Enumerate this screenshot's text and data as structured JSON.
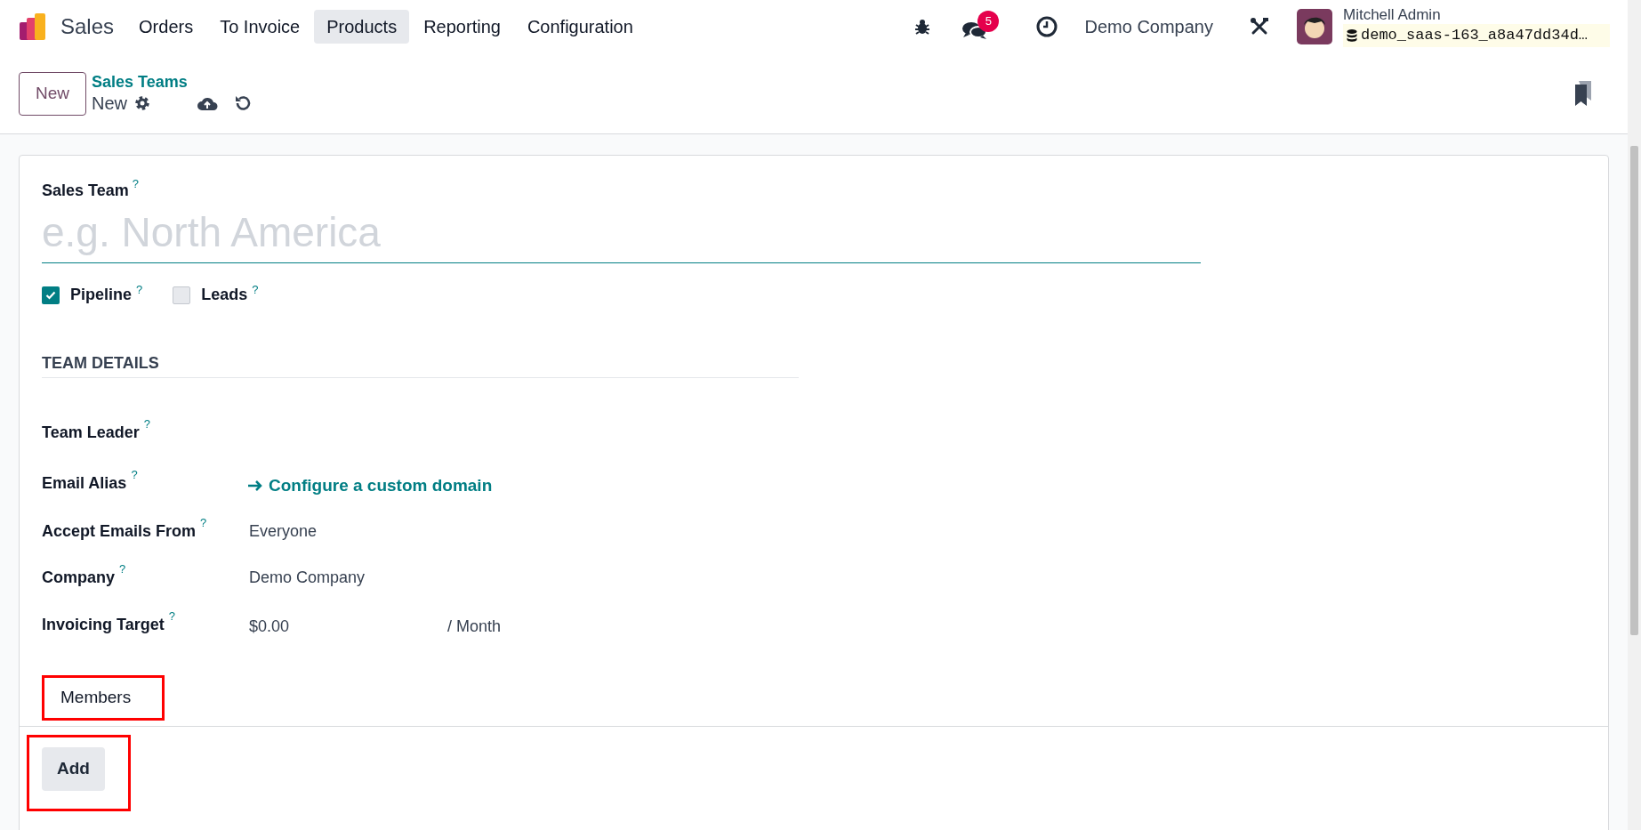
{
  "navbar": {
    "app_name": "Sales",
    "menu": [
      {
        "label": "Orders",
        "selected": false
      },
      {
        "label": "To Invoice",
        "selected": false
      },
      {
        "label": "Products",
        "selected": true
      },
      {
        "label": "Reporting",
        "selected": false
      },
      {
        "label": "Configuration",
        "selected": false
      }
    ],
    "messages_count": "5",
    "company": "Demo Company",
    "user": {
      "name": "Mitchell Admin",
      "database": "demo_saas-163_a8a47dd34d…"
    }
  },
  "control_panel": {
    "new_button": "New",
    "breadcrumb": "Sales Teams",
    "record": "New"
  },
  "form": {
    "name_label": "Sales Team",
    "name_help": "?",
    "name_placeholder": "e.g. North America",
    "options": [
      {
        "label": "Pipeline",
        "help": "?",
        "checked": true
      },
      {
        "label": "Leads",
        "help": "?",
        "checked": false
      }
    ],
    "section_title": "TEAM DETAILS",
    "fields": [
      {
        "kind": "empty",
        "label": "Team Leader",
        "help": "?"
      },
      {
        "kind": "link",
        "label": "Email Alias",
        "help": "?",
        "value": "Configure a custom domain"
      },
      {
        "kind": "text",
        "label": "Accept Emails From",
        "help": "?",
        "value": "Everyone"
      },
      {
        "kind": "text",
        "label": "Company",
        "help": "?",
        "value": "Demo Company"
      },
      {
        "kind": "amount",
        "label": "Invoicing Target",
        "help": "?",
        "value": "$0.00",
        "suffix": "/ Month"
      }
    ],
    "tabs": [
      {
        "label": "Members",
        "selected": true
      }
    ],
    "add_button": "Add"
  }
}
